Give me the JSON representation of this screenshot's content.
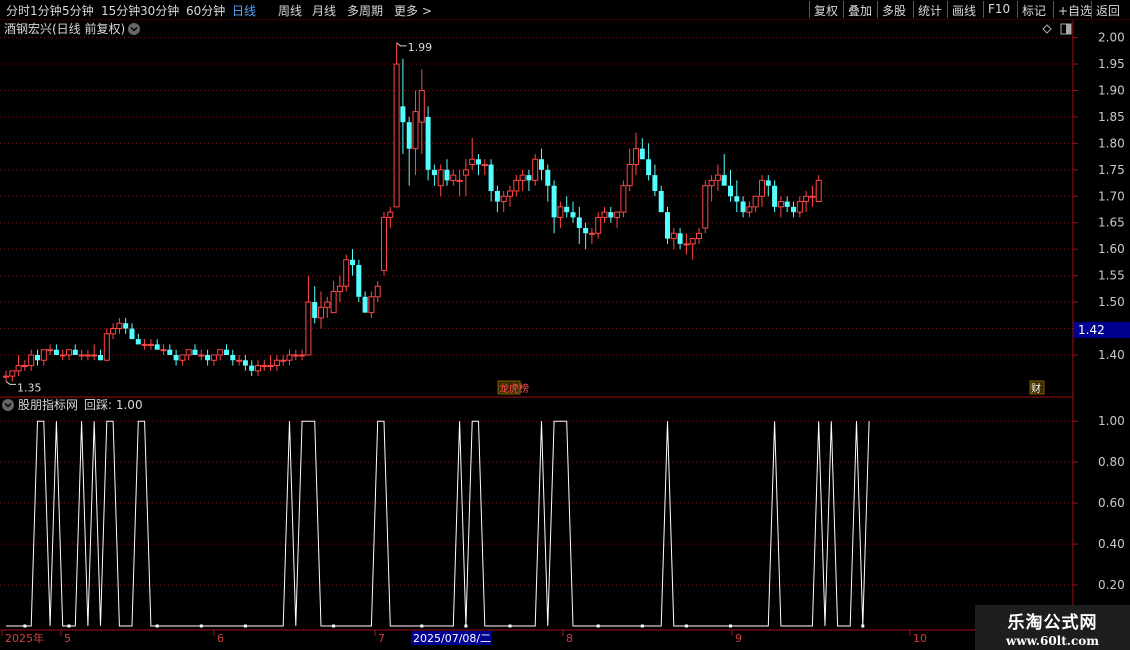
{
  "toolbar": {
    "left_items": [
      {
        "label": "分时",
        "active": false
      },
      {
        "label": "1分钟",
        "active": false
      },
      {
        "label": "5分钟",
        "active": false
      },
      {
        "label": "15分钟",
        "active": false
      },
      {
        "label": "30分钟",
        "active": false
      },
      {
        "label": "60分钟",
        "active": false
      },
      {
        "label": "日线",
        "active": true
      },
      {
        "label": "周线",
        "active": false
      },
      {
        "label": "月线",
        "active": false
      },
      {
        "label": "多周期",
        "active": false
      },
      {
        "label": "更多 >",
        "active": false
      }
    ],
    "right_items": [
      "复权",
      "叠加",
      "多股",
      "统计",
      "画线",
      "F10",
      "标记",
      "+自选",
      "返回"
    ]
  },
  "price_panel": {
    "title": "酒钢宏兴(日线 前复权)",
    "high_label": "1.99",
    "low_label": "1.35",
    "current_price_label": "1.42",
    "event_markers": [
      {
        "label": "龙虎榜",
        "color": "#ff5050"
      },
      {
        "label": "财",
        "color": "#ffffff"
      }
    ]
  },
  "indicator_panel": {
    "title": "股朋指标网",
    "value_label": "回踩: 1.00"
  },
  "time_axis": {
    "labels": [
      "2025年",
      "5",
      "6",
      "7",
      "8",
      "9",
      "10"
    ],
    "cursor_label": "2025/07/08/二"
  },
  "watermark": {
    "line1": "乐淘公式网",
    "line2": "www.60lt.com"
  },
  "colors": {
    "up": "#ff4646",
    "down": "#54ffff",
    "grid": "#7a1010",
    "axis_text": "#c8c8c8",
    "price_box": "#000090",
    "indicator_line": "#ffffff"
  },
  "chart_data": {
    "type": "candlestick",
    "price_ticks": [
      2.0,
      1.95,
      1.9,
      1.85,
      1.8,
      1.75,
      1.7,
      1.65,
      1.6,
      1.55,
      1.5,
      1.45,
      1.4
    ],
    "price_ylim": [
      1.33,
      2.02
    ],
    "candles": [
      [
        1.36,
        1.37,
        1.35,
        1.36
      ],
      [
        1.36,
        1.37,
        1.35,
        1.37
      ],
      [
        1.37,
        1.4,
        1.36,
        1.38
      ],
      [
        1.38,
        1.39,
        1.37,
        1.38
      ],
      [
        1.38,
        1.41,
        1.37,
        1.4
      ],
      [
        1.4,
        1.41,
        1.38,
        1.39
      ],
      [
        1.39,
        1.41,
        1.38,
        1.41
      ],
      [
        1.41,
        1.42,
        1.4,
        1.41
      ],
      [
        1.41,
        1.42,
        1.4,
        1.4
      ],
      [
        1.4,
        1.41,
        1.39,
        1.4
      ],
      [
        1.4,
        1.41,
        1.39,
        1.41
      ],
      [
        1.41,
        1.42,
        1.4,
        1.4
      ],
      [
        1.4,
        1.41,
        1.39,
        1.4
      ],
      [
        1.4,
        1.41,
        1.39,
        1.4
      ],
      [
        1.4,
        1.42,
        1.39,
        1.4
      ],
      [
        1.4,
        1.41,
        1.39,
        1.39
      ],
      [
        1.39,
        1.45,
        1.39,
        1.44
      ],
      [
        1.44,
        1.46,
        1.43,
        1.45
      ],
      [
        1.45,
        1.47,
        1.44,
        1.46
      ],
      [
        1.46,
        1.47,
        1.44,
        1.45
      ],
      [
        1.45,
        1.46,
        1.43,
        1.43
      ],
      [
        1.43,
        1.44,
        1.42,
        1.42
      ],
      [
        1.42,
        1.43,
        1.41,
        1.42
      ],
      [
        1.42,
        1.43,
        1.41,
        1.42
      ],
      [
        1.42,
        1.43,
        1.41,
        1.41
      ],
      [
        1.41,
        1.42,
        1.4,
        1.41
      ],
      [
        1.41,
        1.42,
        1.4,
        1.4
      ],
      [
        1.4,
        1.41,
        1.38,
        1.39
      ],
      [
        1.39,
        1.4,
        1.38,
        1.4
      ],
      [
        1.4,
        1.41,
        1.39,
        1.41
      ],
      [
        1.41,
        1.42,
        1.4,
        1.4
      ],
      [
        1.4,
        1.41,
        1.39,
        1.4
      ],
      [
        1.4,
        1.41,
        1.38,
        1.39
      ],
      [
        1.39,
        1.4,
        1.38,
        1.4
      ],
      [
        1.4,
        1.41,
        1.39,
        1.41
      ],
      [
        1.41,
        1.42,
        1.4,
        1.4
      ],
      [
        1.4,
        1.41,
        1.38,
        1.39
      ],
      [
        1.39,
        1.4,
        1.38,
        1.39
      ],
      [
        1.39,
        1.4,
        1.37,
        1.38
      ],
      [
        1.38,
        1.39,
        1.36,
        1.37
      ],
      [
        1.37,
        1.39,
        1.36,
        1.38
      ],
      [
        1.38,
        1.39,
        1.37,
        1.38
      ],
      [
        1.38,
        1.4,
        1.37,
        1.38
      ],
      [
        1.38,
        1.4,
        1.37,
        1.39
      ],
      [
        1.39,
        1.4,
        1.38,
        1.39
      ],
      [
        1.39,
        1.41,
        1.38,
        1.4
      ],
      [
        1.4,
        1.41,
        1.39,
        1.4
      ],
      [
        1.4,
        1.41,
        1.39,
        1.4
      ],
      [
        1.4,
        1.55,
        1.4,
        1.5
      ],
      [
        1.5,
        1.53,
        1.46,
        1.47
      ],
      [
        1.47,
        1.52,
        1.45,
        1.49
      ],
      [
        1.49,
        1.51,
        1.47,
        1.5
      ],
      [
        1.48,
        1.54,
        1.48,
        1.52
      ],
      [
        1.52,
        1.55,
        1.5,
        1.53
      ],
      [
        1.53,
        1.59,
        1.52,
        1.58
      ],
      [
        1.58,
        1.6,
        1.55,
        1.57
      ],
      [
        1.57,
        1.58,
        1.5,
        1.51
      ],
      [
        1.51,
        1.52,
        1.48,
        1.48
      ],
      [
        1.48,
        1.52,
        1.47,
        1.51
      ],
      [
        1.51,
        1.54,
        1.5,
        1.53
      ],
      [
        1.56,
        1.67,
        1.55,
        1.66
      ],
      [
        1.66,
        1.68,
        1.64,
        1.67
      ],
      [
        1.68,
        1.99,
        1.68,
        1.95
      ],
      [
        1.87,
        1.96,
        1.78,
        1.84
      ],
      [
        1.84,
        1.85,
        1.72,
        1.79
      ],
      [
        1.79,
        1.9,
        1.74,
        1.86
      ],
      [
        1.84,
        1.94,
        1.78,
        1.9
      ],
      [
        1.85,
        1.87,
        1.73,
        1.75
      ],
      [
        1.75,
        1.76,
        1.72,
        1.74
      ],
      [
        1.72,
        1.76,
        1.7,
        1.75
      ],
      [
        1.75,
        1.77,
        1.72,
        1.73
      ],
      [
        1.73,
        1.75,
        1.72,
        1.74
      ],
      [
        1.73,
        1.75,
        1.7,
        1.73
      ],
      [
        1.74,
        1.77,
        1.7,
        1.75
      ],
      [
        1.76,
        1.81,
        1.75,
        1.77
      ],
      [
        1.77,
        1.78,
        1.74,
        1.76
      ],
      [
        1.76,
        1.77,
        1.74,
        1.76
      ],
      [
        1.76,
        1.77,
        1.69,
        1.71
      ],
      [
        1.71,
        1.72,
        1.67,
        1.69
      ],
      [
        1.69,
        1.71,
        1.67,
        1.7
      ],
      [
        1.7,
        1.72,
        1.68,
        1.71
      ],
      [
        1.71,
        1.74,
        1.7,
        1.73
      ],
      [
        1.73,
        1.75,
        1.71,
        1.74
      ],
      [
        1.74,
        1.75,
        1.71,
        1.73
      ],
      [
        1.73,
        1.78,
        1.72,
        1.77
      ],
      [
        1.77,
        1.79,
        1.73,
        1.75
      ],
      [
        1.75,
        1.76,
        1.69,
        1.72
      ],
      [
        1.72,
        1.73,
        1.63,
        1.66
      ],
      [
        1.66,
        1.69,
        1.64,
        1.68
      ],
      [
        1.68,
        1.7,
        1.66,
        1.67
      ],
      [
        1.67,
        1.69,
        1.65,
        1.66
      ],
      [
        1.66,
        1.68,
        1.61,
        1.64
      ],
      [
        1.64,
        1.65,
        1.6,
        1.63
      ],
      [
        1.63,
        1.64,
        1.61,
        1.63
      ],
      [
        1.63,
        1.67,
        1.62,
        1.66
      ],
      [
        1.66,
        1.68,
        1.65,
        1.67
      ],
      [
        1.67,
        1.68,
        1.65,
        1.66
      ],
      [
        1.66,
        1.67,
        1.64,
        1.67
      ],
      [
        1.67,
        1.73,
        1.66,
        1.72
      ],
      [
        1.72,
        1.79,
        1.71,
        1.76
      ],
      [
        1.76,
        1.82,
        1.74,
        1.79
      ],
      [
        1.79,
        1.81,
        1.77,
        1.77
      ],
      [
        1.77,
        1.8,
        1.73,
        1.74
      ],
      [
        1.74,
        1.76,
        1.7,
        1.71
      ],
      [
        1.71,
        1.72,
        1.68,
        1.67
      ],
      [
        1.67,
        1.68,
        1.61,
        1.62
      ],
      [
        1.62,
        1.64,
        1.6,
        1.63
      ],
      [
        1.63,
        1.64,
        1.6,
        1.61
      ],
      [
        1.61,
        1.63,
        1.59,
        1.61
      ],
      [
        1.61,
        1.62,
        1.58,
        1.62
      ],
      [
        1.62,
        1.64,
        1.61,
        1.63
      ],
      [
        1.64,
        1.73,
        1.63,
        1.72
      ],
      [
        1.72,
        1.74,
        1.69,
        1.73
      ],
      [
        1.73,
        1.76,
        1.71,
        1.74
      ],
      [
        1.74,
        1.78,
        1.72,
        1.72
      ],
      [
        1.72,
        1.75,
        1.69,
        1.7
      ],
      [
        1.7,
        1.73,
        1.67,
        1.69
      ],
      [
        1.69,
        1.7,
        1.66,
        1.67
      ],
      [
        1.67,
        1.69,
        1.66,
        1.68
      ],
      [
        1.68,
        1.7,
        1.67,
        1.7
      ],
      [
        1.7,
        1.74,
        1.68,
        1.73
      ],
      [
        1.73,
        1.74,
        1.7,
        1.72
      ],
      [
        1.72,
        1.73,
        1.67,
        1.68
      ],
      [
        1.68,
        1.7,
        1.66,
        1.69
      ],
      [
        1.69,
        1.7,
        1.67,
        1.68
      ],
      [
        1.68,
        1.69,
        1.66,
        1.67
      ],
      [
        1.67,
        1.7,
        1.66,
        1.69
      ],
      [
        1.69,
        1.71,
        1.67,
        1.7
      ],
      [
        1.7,
        1.72,
        1.68,
        1.7
      ],
      [
        1.69,
        1.74,
        1.69,
        1.73
      ]
    ],
    "indicator_ticks": [
      1.0,
      0.8,
      0.6,
      0.4,
      0.2
    ],
    "indicator_ylim": [
      0,
      1.04
    ],
    "indicator_values": [
      0,
      0,
      0,
      0,
      0,
      1,
      1,
      0,
      1,
      0,
      0,
      0,
      1,
      0,
      1,
      0,
      1,
      1,
      0,
      0,
      0,
      1,
      1,
      0,
      0,
      0,
      0,
      0,
      0,
      0,
      0,
      0,
      0,
      0,
      0,
      0,
      0,
      0,
      0,
      0,
      0,
      0,
      0,
      0,
      0,
      1,
      0,
      1,
      1,
      1,
      0,
      0,
      0,
      0,
      0,
      0,
      0,
      0,
      0,
      1,
      1,
      0,
      0,
      0,
      0,
      0,
      0,
      0,
      0,
      0,
      0,
      0,
      1,
      0,
      1,
      1,
      0,
      0,
      0,
      0,
      0,
      0,
      0,
      0,
      0,
      1,
      0,
      1,
      1,
      1,
      0,
      0,
      0,
      0,
      0,
      0,
      0,
      0,
      0,
      0,
      0,
      0,
      0,
      0,
      0,
      1,
      0,
      0,
      0,
      0,
      0,
      0,
      0,
      0,
      0,
      0,
      0,
      0,
      0,
      0,
      0,
      0,
      1,
      0,
      0,
      0,
      0,
      0,
      0,
      1,
      0,
      1,
      0,
      0,
      0,
      1,
      0,
      1
    ]
  }
}
